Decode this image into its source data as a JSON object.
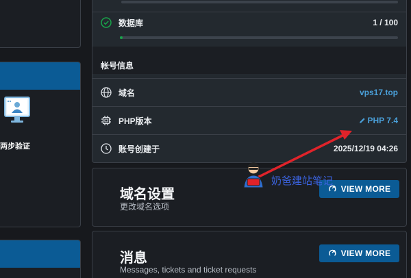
{
  "sidebar": {
    "two_step_label": "两步验证"
  },
  "panel": {
    "database": {
      "label": "数据库",
      "value": "1 / 100",
      "progress": 0.01
    },
    "account_section": "帐号信息",
    "domain": {
      "label": "域名",
      "value": "vps17.top"
    },
    "php": {
      "label": "PHP版本",
      "value": "PHP 7.4"
    },
    "created": {
      "label": "账号创建于",
      "value": "2025/12/19 04:26"
    }
  },
  "domain_card": {
    "title": "域名设置",
    "subtitle": "更改域名选项",
    "button": "VIEW MORE"
  },
  "messages_card": {
    "title": "消息",
    "subtitle": "Messages, tickets and ticket requests",
    "button": "VIEW MORE"
  },
  "watermark": {
    "text": "奶爸建站笔记"
  },
  "colors": {
    "accent": "#0b5b95",
    "link": "#4a9fd8",
    "success": "#19a34a",
    "annotation": "#e0232a"
  }
}
